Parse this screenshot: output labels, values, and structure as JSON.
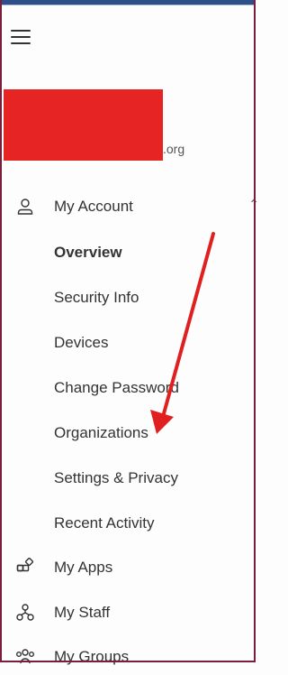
{
  "header": {
    "menu_icon": "hamburger-menu-icon"
  },
  "account": {
    "org_suffix": ".org",
    "redaction_color": "#e62424"
  },
  "nav": {
    "my_account": {
      "label": "My Account",
      "icon": "person-icon"
    },
    "sub_items": [
      {
        "label": "Overview",
        "selected": true
      },
      {
        "label": "Security Info"
      },
      {
        "label": "Devices"
      },
      {
        "label": "Change Password"
      },
      {
        "label": "Organizations"
      },
      {
        "label": "Settings & Privacy"
      },
      {
        "label": "Recent Activity"
      }
    ],
    "my_apps": {
      "label": "My Apps",
      "icon": "apps-icon"
    },
    "my_staff": {
      "label": "My Staff",
      "icon": "staff-icon"
    },
    "my_groups": {
      "label": "My Groups",
      "icon": "groups-icon"
    }
  },
  "annotation": {
    "arrow_color": "#e02020"
  },
  "colors": {
    "top_bar": "#2e4e87",
    "frame_border": "#7a1e3c"
  }
}
